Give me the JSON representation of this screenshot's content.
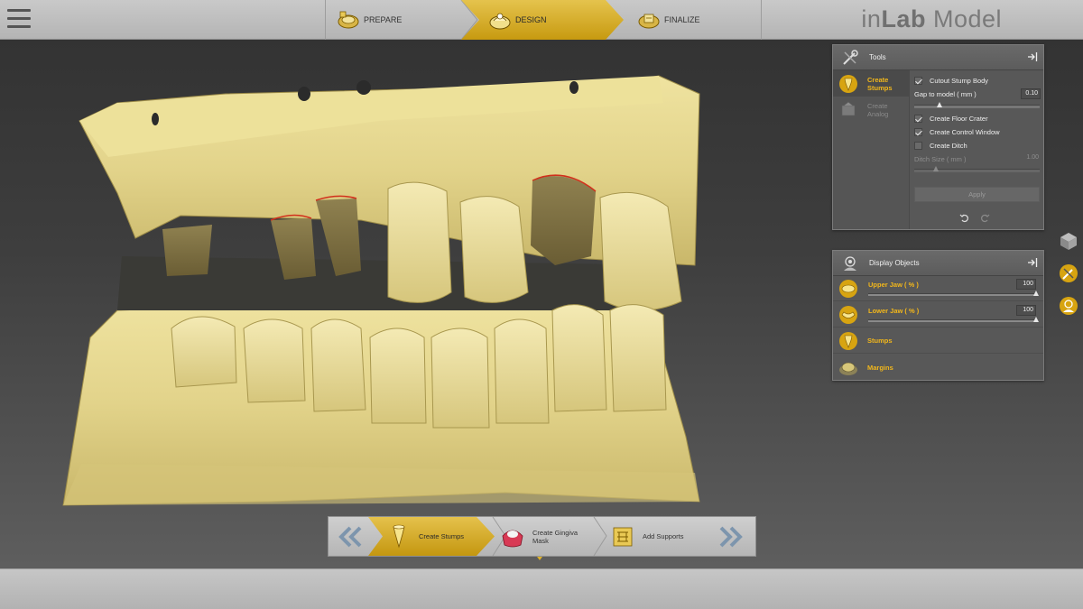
{
  "app": {
    "brand_light": "in",
    "brand_bold": "Lab",
    "brand_suffix": " Model"
  },
  "phases": [
    {
      "label": "PREPARE",
      "icon": "prepare-icon",
      "active": false
    },
    {
      "label": "DESIGN",
      "icon": "design-icon",
      "active": true
    },
    {
      "label": "FINALIZE",
      "icon": "finalize-icon",
      "active": false
    }
  ],
  "tools_panel": {
    "title": "Tools",
    "entries": [
      {
        "label_line1": "Create",
        "label_line2": "Stumps",
        "active": true
      },
      {
        "label_line1": "Create",
        "label_line2": "Analog",
        "active": false
      }
    ],
    "options": {
      "cutout_stump_body": {
        "label": "Cutout Stump Body",
        "checked": true
      },
      "gap_to_model": {
        "label": "Gap to model  ( mm )",
        "value": "0.10",
        "slider_fraction": 0.18
      },
      "create_floor_crater": {
        "label": "Create Floor Crater",
        "checked": true
      },
      "create_control_window": {
        "label": "Create Control Window",
        "checked": true
      },
      "create_ditch": {
        "label": "Create Ditch",
        "checked": false
      },
      "ditch_size": {
        "label": "Ditch Size  ( mm )",
        "value": "1.00",
        "slider_fraction": 0.15
      },
      "apply_label": "Apply"
    }
  },
  "display_panel": {
    "title": "Display Objects",
    "upper_jaw": {
      "label": "Upper Jaw  ( % )",
      "value": "100"
    },
    "lower_jaw": {
      "label": "Lower Jaw  ( % )",
      "value": "100"
    },
    "stumps_label": "Stumps",
    "margins_label": "Margins"
  },
  "steps": [
    {
      "label": "Create Stumps",
      "active": true
    },
    {
      "label_line1": "Create Gingiva",
      "label_line2": "Mask",
      "active": false
    },
    {
      "label": "Add Supports",
      "active": false
    }
  ],
  "colors": {
    "accent": "#E0B22A",
    "model": "#E6DA95",
    "panel": "#585858"
  }
}
